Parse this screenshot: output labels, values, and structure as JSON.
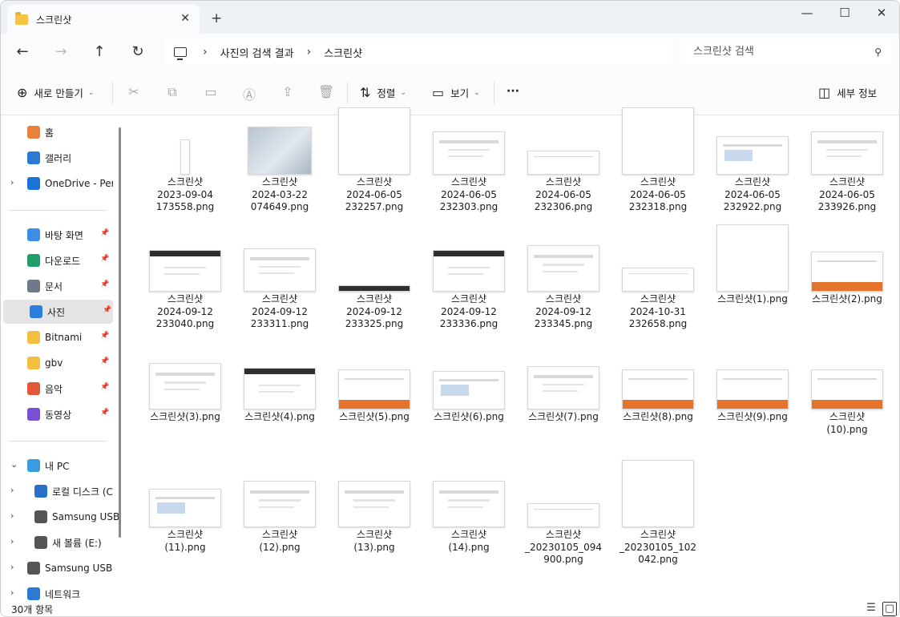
{
  "window": {
    "tab_title": "스크린샷",
    "controls": {
      "minimize": "—",
      "maximize": "☐",
      "close": "✕"
    }
  },
  "address": {
    "crumbs": [
      "사진의 검색 결과",
      "스크린샷"
    ],
    "search_placeholder": "스크린샷 검색"
  },
  "toolbar": {
    "new_label": "새로 만들기",
    "sort_label": "정렬",
    "view_label": "보기",
    "more_label": "···",
    "details_label": "세부 정보"
  },
  "sidebar": {
    "quick": [
      {
        "label": "홈",
        "icon": "home-icon",
        "color": "#e8823a"
      },
      {
        "label": "갤러리",
        "icon": "gallery-icon",
        "color": "#2a7bd4"
      },
      {
        "label": "OneDrive - Pers",
        "icon": "onedrive-icon",
        "color": "#1a73d8"
      }
    ],
    "pinned": [
      {
        "label": "바탕 화면",
        "icon": "desktop-icon",
        "color": "#3a8ee6"
      },
      {
        "label": "다운로드",
        "icon": "download-icon",
        "color": "#1f9e69"
      },
      {
        "label": "문서",
        "icon": "document-icon",
        "color": "#6f7a88"
      },
      {
        "label": "사진",
        "icon": "pictures-icon",
        "color": "#2b7de0"
      },
      {
        "label": "Bitnami",
        "icon": "folder-icon",
        "color": "#f3bf3c"
      },
      {
        "label": "gbv",
        "icon": "folder-icon",
        "color": "#f3bf3c"
      },
      {
        "label": "음악",
        "icon": "music-icon",
        "color": "#e2573a"
      },
      {
        "label": "동영상",
        "icon": "video-icon",
        "color": "#7a4fd6"
      }
    ],
    "drives": [
      {
        "label": "내 PC",
        "icon": "pc-icon",
        "color": "#3a9be0"
      },
      {
        "label": "로컬 디스크 (C",
        "icon": "windows-drive-icon",
        "color": "#2a6fc7"
      },
      {
        "label": "Samsung USB",
        "icon": "usb-drive-icon",
        "color": "#555555"
      },
      {
        "label": "새 볼륨 (E:)",
        "icon": "usb-drive-icon",
        "color": "#555555"
      },
      {
        "label": "Samsung USB (",
        "icon": "usb-drive-icon",
        "color": "#555555"
      },
      {
        "label": "네트워크",
        "icon": "network-icon",
        "color": "#2a7bd4"
      }
    ]
  },
  "files": [
    {
      "name": "스크린샷\n2023-09-04\n173558.png",
      "style": "tall"
    },
    {
      "name": "스크린샷\n2024-03-22\n074649.png",
      "style": "wall"
    },
    {
      "name": "스크린샷\n2024-06-05\n232257.png",
      "style": "blank"
    },
    {
      "name": "스크린샷\n2024-06-05\n232303.png",
      "style": "dialog"
    },
    {
      "name": "스크린샷\n2024-06-05\n232306.png",
      "style": "wide"
    },
    {
      "name": "스크린샷\n2024-06-05\n232318.png",
      "style": "blank"
    },
    {
      "name": "스크린샷\n2024-06-05\n232922.png",
      "style": "blue"
    },
    {
      "name": "스크린샷\n2024-06-05\n233926.png",
      "style": "dialog"
    },
    {
      "name": "스크린샷\n2024-09-12\n233040.png",
      "style": "darktop"
    },
    {
      "name": "스크린샷\n2024-09-12\n233311.png",
      "style": "dialog"
    },
    {
      "name": "스크린샷\n2024-09-12\n233325.png",
      "style": "strip"
    },
    {
      "name": "스크린샷\n2024-09-12\n233336.png",
      "style": "darktop"
    },
    {
      "name": "스크린샷\n2024-09-12\n233345.png",
      "style": "text"
    },
    {
      "name": "스크린샷\n2024-10-31\n232658.png",
      "style": "wide"
    },
    {
      "name": "스크린샷(1).png",
      "style": "blank"
    },
    {
      "name": "스크린샷(2).png",
      "style": "orange"
    },
    {
      "name": "스크린샷(3).png",
      "style": "text"
    },
    {
      "name": "스크린샷(4).png",
      "style": "darktop"
    },
    {
      "name": "스크린샷(5).png",
      "style": "orange"
    },
    {
      "name": "스크린샷(6).png",
      "style": "blue"
    },
    {
      "name": "스크린샷(7).png",
      "style": "dialog"
    },
    {
      "name": "스크린샷(8).png",
      "style": "orange"
    },
    {
      "name": "스크린샷(9).png",
      "style": "orange"
    },
    {
      "name": "스크린샷\n(10).png",
      "style": "orange"
    },
    {
      "name": "스크린샷\n(11).png",
      "style": "blue"
    },
    {
      "name": "스크린샷\n(12).png",
      "style": "text"
    },
    {
      "name": "스크린샷\n(13).png",
      "style": "text"
    },
    {
      "name": "스크린샷\n(14).png",
      "style": "text"
    },
    {
      "name": "스크린샷\n_20230105_094\n900.png",
      "style": "wide"
    },
    {
      "name": "스크린샷\n_20230105_102\n042.png",
      "style": "blank"
    }
  ],
  "status": {
    "count": "30개 항목"
  }
}
